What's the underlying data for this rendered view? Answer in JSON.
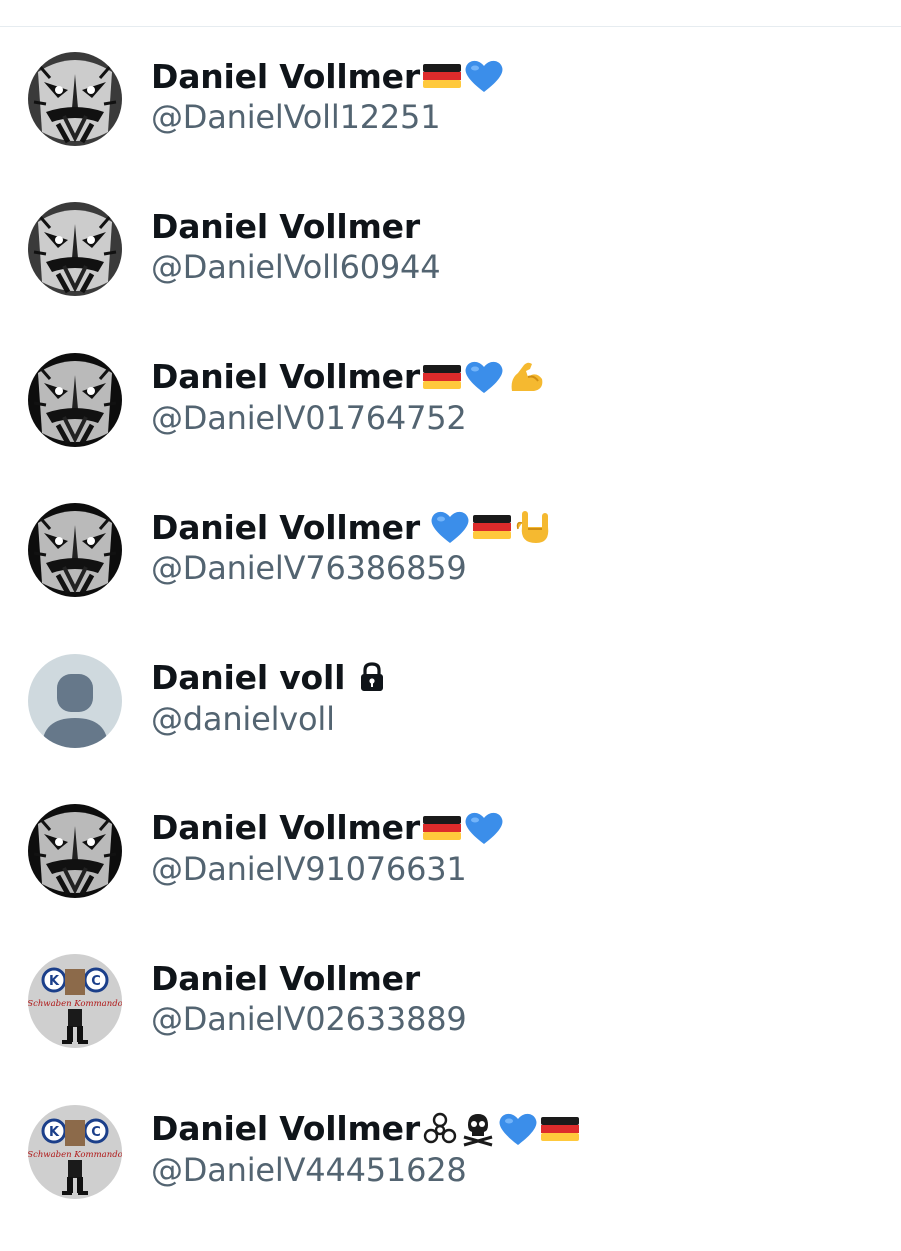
{
  "accounts": [
    {
      "name": "Daniel Vollmer",
      "handle": "@DanielVoll12251",
      "avatar": "mask-avatar-gray",
      "badges": [
        "german-flag-icon",
        "blue-heart-icon"
      ]
    },
    {
      "name": "Daniel Vollmer",
      "handle": "@DanielVoll60944",
      "avatar": "mask-avatar-gray",
      "badges": []
    },
    {
      "name": "Daniel Vollmer",
      "handle": "@DanielV01764752",
      "avatar": "mask-avatar-dark",
      "badges": [
        "german-flag-icon",
        "blue-heart-icon",
        "flexed-biceps-icon"
      ]
    },
    {
      "name": "Daniel Vollmer",
      "handle": "@DanielV76386859",
      "avatar": "mask-avatar-dark",
      "badges": [
        "blue-heart-icon",
        "german-flag-icon",
        "rock-on-hand-icon"
      ]
    },
    {
      "name": "Daniel voll",
      "handle": "@danielvoll",
      "avatar": "default-avatar",
      "badges": [
        "lock-icon"
      ]
    },
    {
      "name": "Daniel Vollmer",
      "handle": "@DanielV91076631",
      "avatar": "mask-avatar-dark",
      "badges": [
        "german-flag-icon",
        "blue-heart-icon"
      ]
    },
    {
      "name": "Daniel Vollmer",
      "handle": "@DanielV02633889",
      "avatar": "schwaben-kommando-avatar",
      "badges": []
    },
    {
      "name": "Daniel Vollmer",
      "handle": "@DanielV44451628",
      "avatar": "schwaben-kommando-avatar",
      "badges": [
        "biohazard-icon",
        "skull-crossbones-icon",
        "blue-heart-icon",
        "german-flag-icon"
      ]
    }
  ],
  "avatar_logo_text": "Schwaben Kommando",
  "colors": {
    "name_text": "#0f1419",
    "handle_text": "#536471",
    "divider": "#e6ecf0",
    "blue_heart": "#3b8eea",
    "default_avatar_bg": "#cfd9de",
    "default_avatar_fg": "#66788a"
  }
}
